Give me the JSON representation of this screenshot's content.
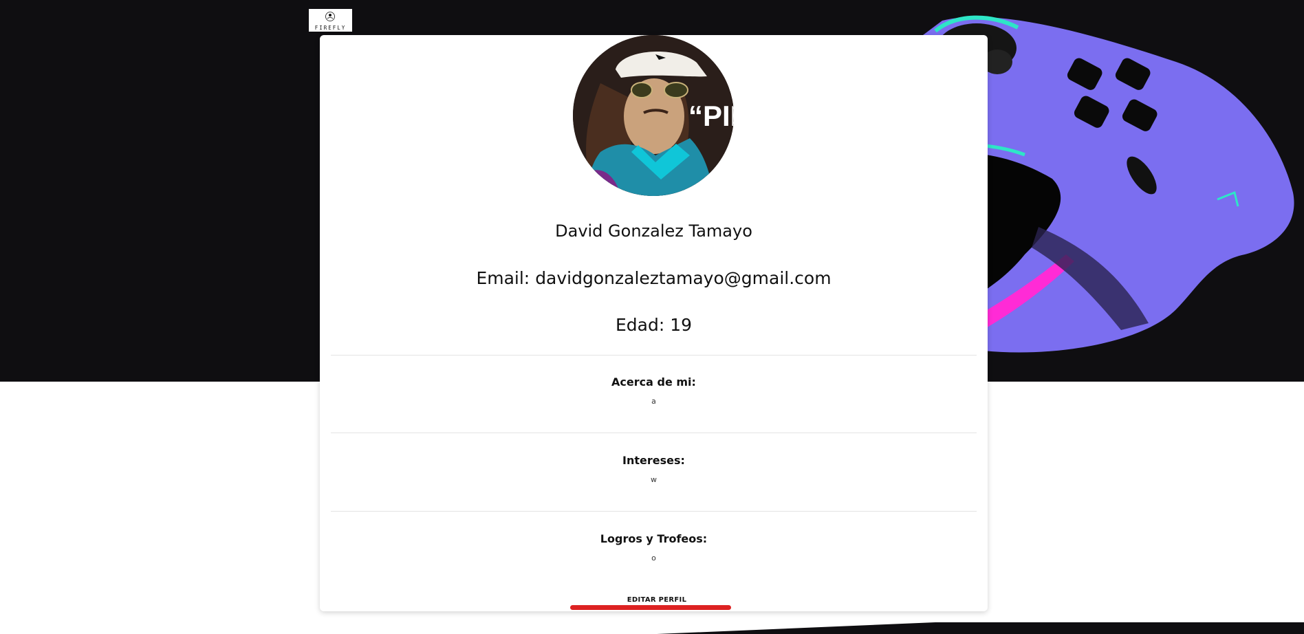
{
  "brand": {
    "logo_text": "FIREFLY"
  },
  "profile": {
    "name": "David Gonzalez Tamayo",
    "email_label": "Email:",
    "email": "davidgonzaleztamayo@gmail.com",
    "age_label": "Edad:",
    "age": "19",
    "avatar_text": "“PIEN"
  },
  "sections": [
    {
      "title": "Acerca de mi:",
      "value": "a"
    },
    {
      "title": "Intereses:",
      "value": "w"
    },
    {
      "title": "Logros y Trofeos:",
      "value": "o"
    }
  ],
  "actions": {
    "edit_label": "EDITAR PERFIL"
  },
  "colors": {
    "hero_bg": "#0f0e11",
    "accent": "#dd2222",
    "controller": "#7b6ef0",
    "controller_glow": "#ff2bd6"
  }
}
